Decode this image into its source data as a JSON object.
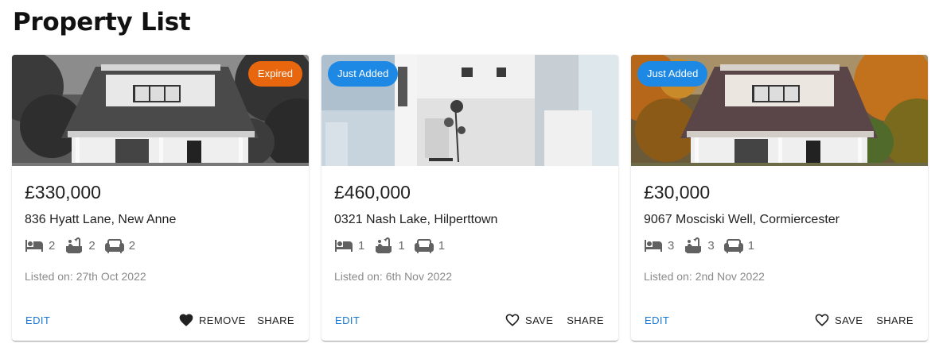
{
  "page": {
    "title": "Property List"
  },
  "colors": {
    "expired": "#e8660d",
    "just_added": "#1e88e5",
    "edit": "#1976d2",
    "icon": "#616161"
  },
  "icons": {
    "bed": "bed-icon",
    "bath": "bathtub-icon",
    "sofa": "sofa-icon",
    "heart_filled": "heart-filled-icon",
    "heart_outline": "heart-outline-icon"
  },
  "cards": [
    {
      "badge": "Expired",
      "price": "£330,000",
      "address": "836 Hyatt Lane, New Anne",
      "beds": "2",
      "baths": "2",
      "living": "2",
      "listed_label": "Listed on:",
      "listed_date": "27th Oct 2022",
      "edit_label": "EDIT",
      "fav_label": "REMOVE",
      "share_label": "SHARE"
    },
    {
      "badge": "Just Added",
      "price": "£460,000",
      "address": "0321 Nash Lake, Hilperttown",
      "beds": "1",
      "baths": "1",
      "living": "1",
      "listed_label": "Listed on:",
      "listed_date": "6th Nov 2022",
      "edit_label": "EDIT",
      "fav_label": "SAVE",
      "share_label": "SHARE"
    },
    {
      "badge": "Just Added",
      "price": "£30,000",
      "address": "9067 Mosciski Well, Cormiercester",
      "beds": "3",
      "baths": "3",
      "living": "1",
      "listed_label": "Listed on:",
      "listed_date": "2nd Nov 2022",
      "edit_label": "EDIT",
      "fav_label": "SAVE",
      "share_label": "SHARE"
    }
  ]
}
